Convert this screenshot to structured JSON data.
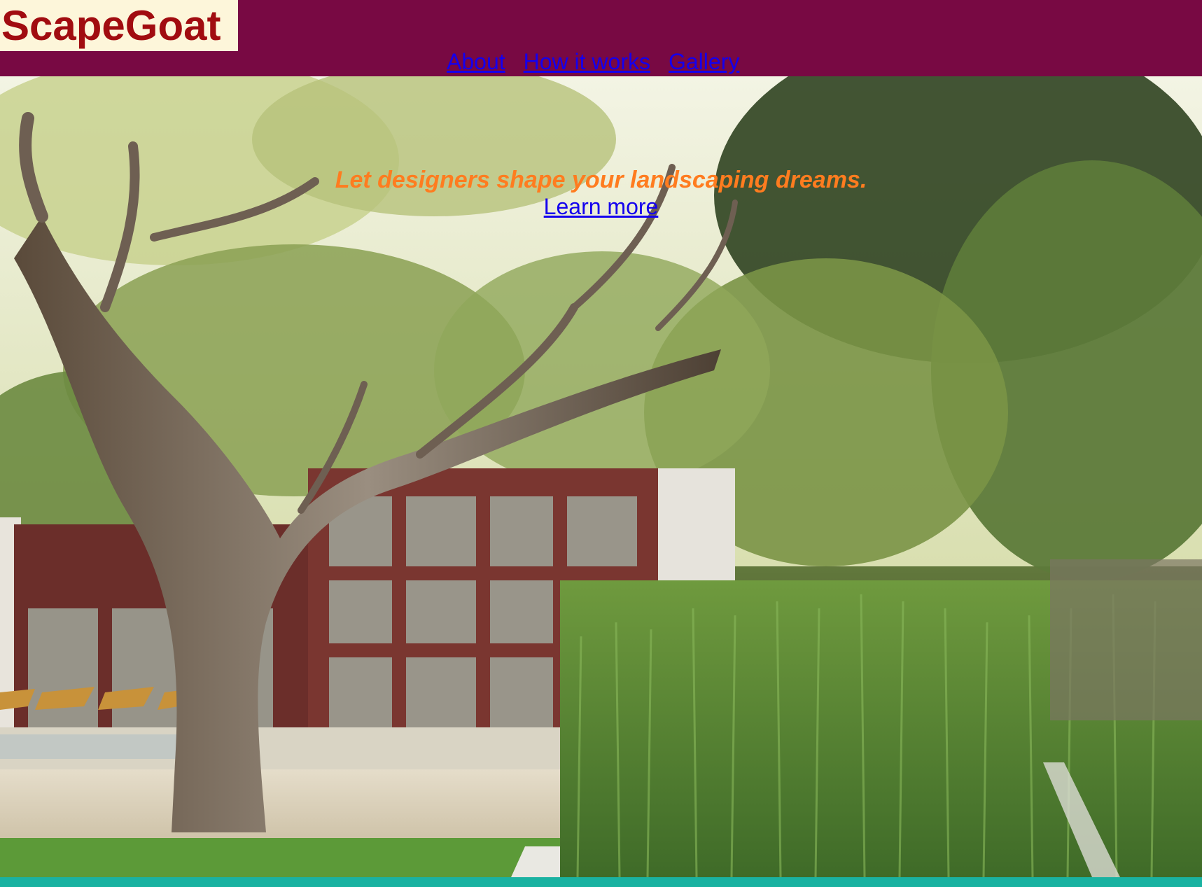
{
  "brand": {
    "name": "ScapeGoat"
  },
  "nav": {
    "items": [
      {
        "label": "About"
      },
      {
        "label": "How it works"
      },
      {
        "label": "Gallery"
      }
    ]
  },
  "hero": {
    "tagline": "Let designers shape your landscaping dreams.",
    "cta_label": "Learn more",
    "image_icon": "garden-photo"
  },
  "colors": {
    "header_bg": "#780943",
    "logo_bg": "#fdf6da",
    "logo_text": "#a10c10",
    "link": "#1400ee",
    "tagline": "#ff7c1f",
    "footer_bar": "#1ab2a1"
  }
}
